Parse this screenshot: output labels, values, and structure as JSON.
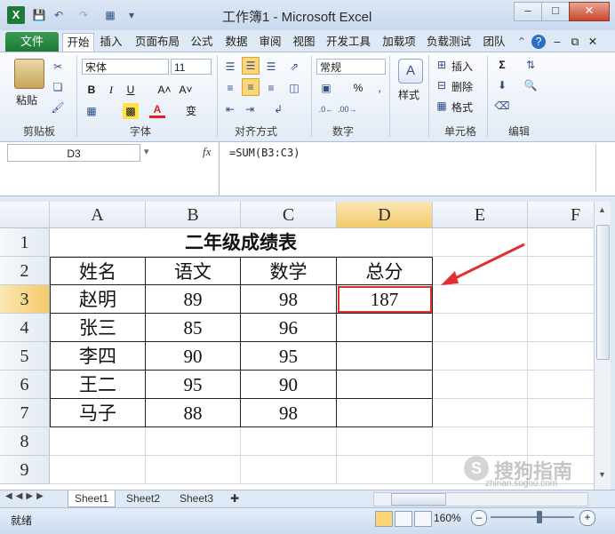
{
  "window": {
    "title": "工作簿1 - Microsoft Excel",
    "app_icon": "X",
    "controls": [
      "–",
      "□",
      "✕"
    ]
  },
  "quick_access": [
    "save-icon",
    "undo-icon",
    "redo-icon",
    "customize-icon"
  ],
  "tabs": {
    "file": "文件",
    "items": [
      "开始",
      "插入",
      "页面布局",
      "公式",
      "数据",
      "审阅",
      "视图",
      "开发工具",
      "加载项",
      "负载测试",
      "团队"
    ],
    "active": "开始"
  },
  "ribbon": {
    "clipboard": {
      "label": "剪贴板",
      "paste": "粘贴"
    },
    "font": {
      "label": "字体",
      "name": "宋体",
      "size": "11",
      "bold": "B",
      "italic": "I",
      "underline": "U",
      "grow": "A˄",
      "shrink": "A˅",
      "phonetic": "变"
    },
    "alignment": {
      "label": "对齐方式"
    },
    "number": {
      "label": "数字",
      "format": "常规",
      "percent": "%",
      "comma": ","
    },
    "styles": {
      "label": "样式",
      "button": "样式"
    },
    "cells": {
      "label": "单元格",
      "insert": "插入",
      "delete": "删除",
      "format": "格式"
    },
    "editing": {
      "label": "编辑",
      "sum": "Σ"
    }
  },
  "formula_bar": {
    "name_box": "D3",
    "fx": "fx",
    "formula": "=SUM(B3:C3)"
  },
  "sheet": {
    "columns": [
      "A",
      "B",
      "C",
      "D",
      "E",
      "F"
    ],
    "selected_column": "D",
    "selected_row": "3",
    "rows": [
      "1",
      "2",
      "3",
      "4",
      "5",
      "6",
      "7",
      "8",
      "9"
    ],
    "title": "二年级成绩表",
    "headers": [
      "姓名",
      "语文",
      "数学",
      "总分"
    ],
    "data": [
      [
        "赵明",
        "89",
        "98",
        "187"
      ],
      [
        "张三",
        "85",
        "96",
        ""
      ],
      [
        "李四",
        "90",
        "95",
        ""
      ],
      [
        "王二",
        "95",
        "90",
        ""
      ],
      [
        "马子",
        "88",
        "98",
        ""
      ]
    ],
    "annotation_color": "#e03030"
  },
  "sheet_tabs": [
    "Sheet1",
    "Sheet2",
    "Sheet3"
  ],
  "status": {
    "mode": "就绪",
    "zoom": "160%",
    "watermark": "搜狗指南",
    "watermark_url": "zhinan.sogou.com"
  }
}
